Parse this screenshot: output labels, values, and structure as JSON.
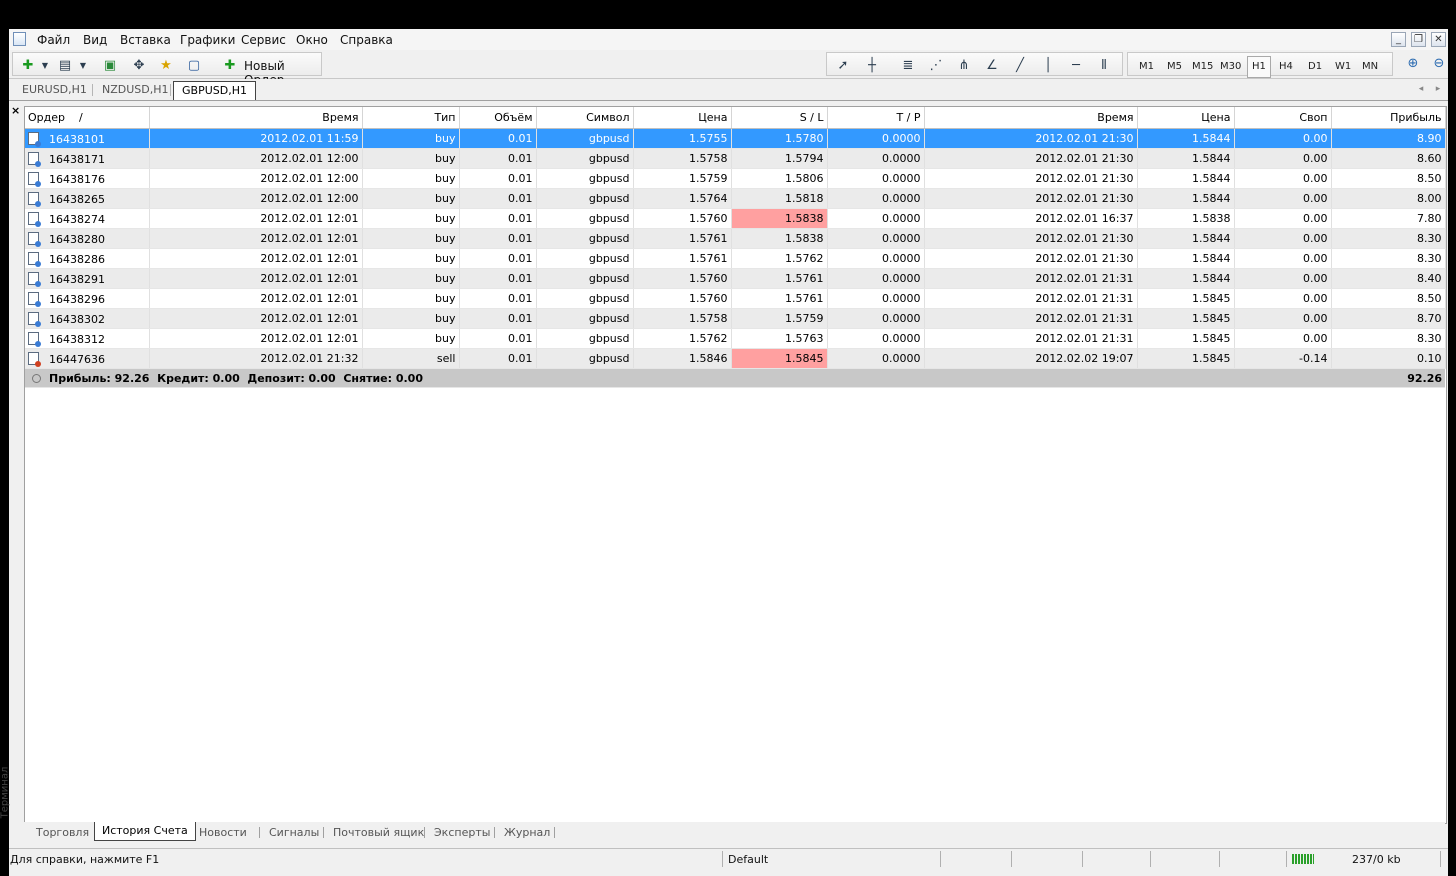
{
  "menu": [
    "Файл",
    "Вид",
    "Вставка",
    "Графики",
    "Сервис",
    "Окно",
    "Справка"
  ],
  "toolbar": {
    "new_order_label": "Новый Ордер",
    "timeframes": [
      "M1",
      "M5",
      "M15",
      "M30",
      "H1",
      "H4",
      "D1",
      "W1",
      "MN"
    ],
    "active_timeframe": "H1"
  },
  "chart_tabs": [
    "EURUSD,H1",
    "NZDUSD,H1",
    "GBPUSD,H1"
  ],
  "active_chart_tab": "GBPUSD,H1",
  "table": {
    "columns": [
      "Ордер",
      "Время",
      "Тип",
      "Объём",
      "Символ",
      "Цена",
      "S / L",
      "T / P",
      "Время",
      "Цена",
      "Своп",
      "Прибыль"
    ],
    "sort_indicator": "/",
    "rows": [
      {
        "order": "16438101",
        "open_time": "2012.02.01 11:59",
        "type": "buy",
        "volume": "0.01",
        "symbol": "gbpusd",
        "open_price": "1.5755",
        "sl": "1.5780",
        "tp": "0.0000",
        "close_time": "2012.02.01 21:30",
        "close_price": "1.5844",
        "swap": "0.00",
        "profit": "8.90"
      },
      {
        "order": "16438171",
        "open_time": "2012.02.01 12:00",
        "type": "buy",
        "volume": "0.01",
        "symbol": "gbpusd",
        "open_price": "1.5758",
        "sl": "1.5794",
        "tp": "0.0000",
        "close_time": "2012.02.01 21:30",
        "close_price": "1.5844",
        "swap": "0.00",
        "profit": "8.60"
      },
      {
        "order": "16438176",
        "open_time": "2012.02.01 12:00",
        "type": "buy",
        "volume": "0.01",
        "symbol": "gbpusd",
        "open_price": "1.5759",
        "sl": "1.5806",
        "tp": "0.0000",
        "close_time": "2012.02.01 21:30",
        "close_price": "1.5844",
        "swap": "0.00",
        "profit": "8.50"
      },
      {
        "order": "16438265",
        "open_time": "2012.02.01 12:00",
        "type": "buy",
        "volume": "0.01",
        "symbol": "gbpusd",
        "open_price": "1.5764",
        "sl": "1.5818",
        "tp": "0.0000",
        "close_time": "2012.02.01 21:30",
        "close_price": "1.5844",
        "swap": "0.00",
        "profit": "8.00"
      },
      {
        "order": "16438274",
        "open_time": "2012.02.01 12:01",
        "type": "buy",
        "volume": "0.01",
        "symbol": "gbpusd",
        "open_price": "1.5760",
        "sl": "1.5838",
        "tp": "0.0000",
        "close_time": "2012.02.01 16:37",
        "close_price": "1.5838",
        "swap": "0.00",
        "profit": "7.80"
      },
      {
        "order": "16438280",
        "open_time": "2012.02.01 12:01",
        "type": "buy",
        "volume": "0.01",
        "symbol": "gbpusd",
        "open_price": "1.5761",
        "sl": "1.5838",
        "tp": "0.0000",
        "close_time": "2012.02.01 21:30",
        "close_price": "1.5844",
        "swap": "0.00",
        "profit": "8.30"
      },
      {
        "order": "16438286",
        "open_time": "2012.02.01 12:01",
        "type": "buy",
        "volume": "0.01",
        "symbol": "gbpusd",
        "open_price": "1.5761",
        "sl": "1.5762",
        "tp": "0.0000",
        "close_time": "2012.02.01 21:30",
        "close_price": "1.5844",
        "swap": "0.00",
        "profit": "8.30"
      },
      {
        "order": "16438291",
        "open_time": "2012.02.01 12:01",
        "type": "buy",
        "volume": "0.01",
        "symbol": "gbpusd",
        "open_price": "1.5760",
        "sl": "1.5761",
        "tp": "0.0000",
        "close_time": "2012.02.01 21:31",
        "close_price": "1.5844",
        "swap": "0.00",
        "profit": "8.40"
      },
      {
        "order": "16438296",
        "open_time": "2012.02.01 12:01",
        "type": "buy",
        "volume": "0.01",
        "symbol": "gbpusd",
        "open_price": "1.5760",
        "sl": "1.5761",
        "tp": "0.0000",
        "close_time": "2012.02.01 21:31",
        "close_price": "1.5845",
        "swap": "0.00",
        "profit": "8.50"
      },
      {
        "order": "16438302",
        "open_time": "2012.02.01 12:01",
        "type": "buy",
        "volume": "0.01",
        "symbol": "gbpusd",
        "open_price": "1.5758",
        "sl": "1.5759",
        "tp": "0.0000",
        "close_time": "2012.02.01 21:31",
        "close_price": "1.5845",
        "swap": "0.00",
        "profit": "8.70"
      },
      {
        "order": "16438312",
        "open_time": "2012.02.01 12:01",
        "type": "buy",
        "volume": "0.01",
        "symbol": "gbpusd",
        "open_price": "1.5762",
        "sl": "1.5763",
        "tp": "0.0000",
        "close_time": "2012.02.01 21:31",
        "close_price": "1.5845",
        "swap": "0.00",
        "profit": "8.30"
      },
      {
        "order": "16447636",
        "open_time": "2012.02.01 21:32",
        "type": "sell",
        "volume": "0.01",
        "symbol": "gbpusd",
        "open_price": "1.5846",
        "sl": "1.5845",
        "tp": "0.0000",
        "close_time": "2012.02.02 19:07",
        "close_price": "1.5845",
        "swap": "-0.14",
        "profit": "0.10"
      }
    ],
    "selected_row": 0,
    "highlighted_sl_rows": [
      4,
      11
    ],
    "highlight_color": "#ffa0a0",
    "selection_color": "#3399ff",
    "summary": {
      "text": "Прибыль: 92.26  Кредит: 0.00  Депозит: 0.00  Снятие: 0.00",
      "total": "92.26"
    }
  },
  "terminal_label": "Терминал",
  "bottom_tabs": [
    "Торговля",
    "История Счета",
    "Новости",
    "Сигналы",
    "Почтовый ящик",
    "Эксперты",
    "Журнал"
  ],
  "active_bottom_tab": "История Счета",
  "statusbar": {
    "help": "Для справки, нажмите F1",
    "profile": "Default",
    "traffic": "237/0 kb"
  }
}
